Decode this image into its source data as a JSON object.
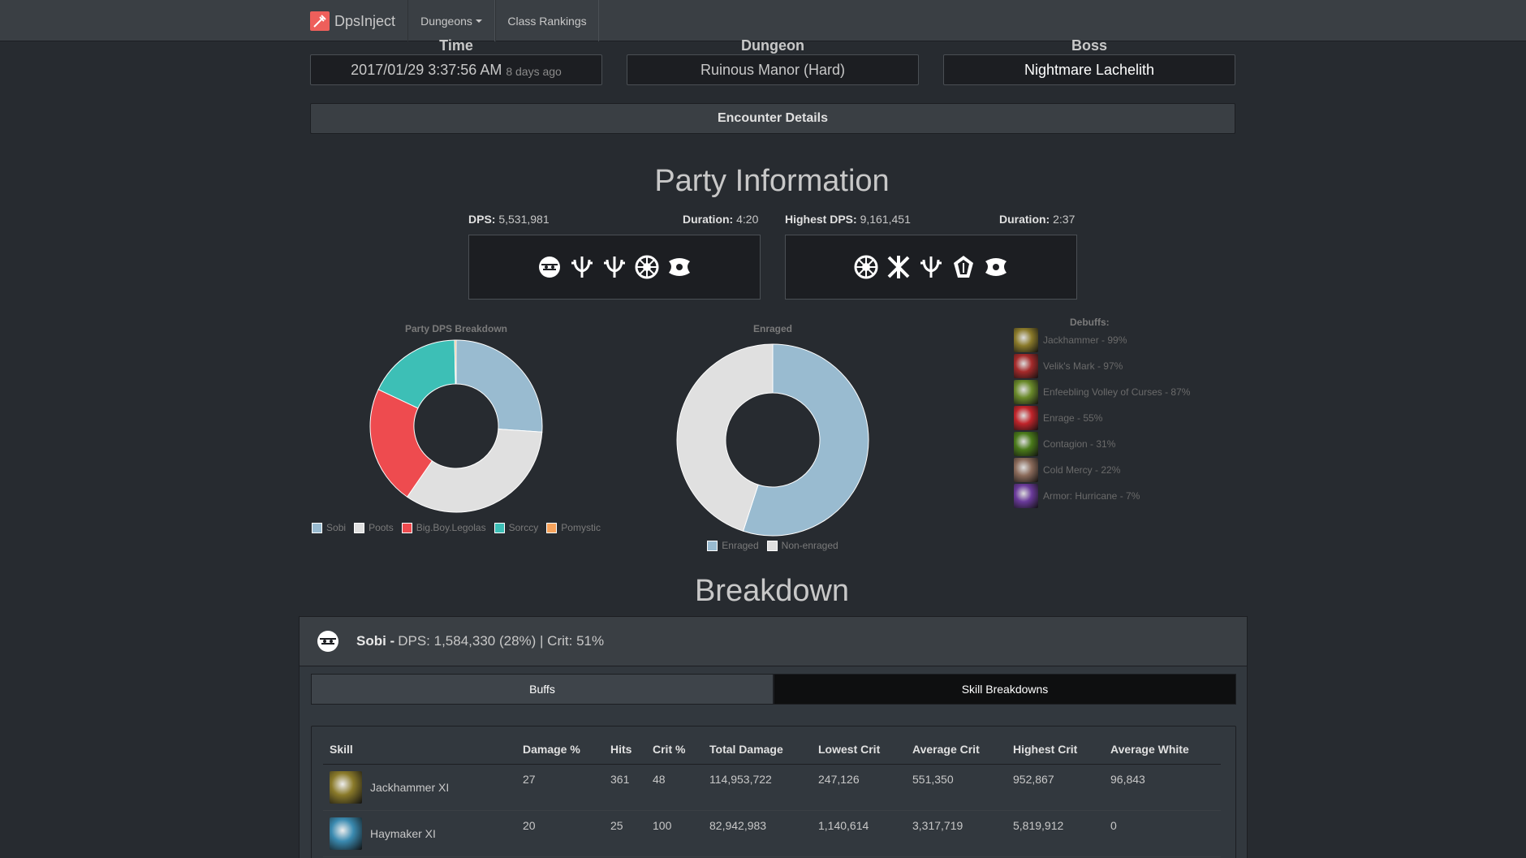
{
  "nav": {
    "brand": "DpsInject",
    "dungeons": "Dungeons",
    "class_rankings": "Class Rankings"
  },
  "meta": {
    "time_label": "Time",
    "time_value": "2017/01/29 3:37:56 AM",
    "time_ago": "8 days ago",
    "dungeon_label": "Dungeon",
    "dungeon_value": "Ruinous Manor (Hard)",
    "boss_label": "Boss",
    "boss_value": "Nightmare Lachelith"
  },
  "encounter_details": "Encounter Details",
  "party": {
    "heading": "Party Information",
    "dps_label": "DPS:",
    "dps_value": "5,531,981",
    "duration_label": "Duration:",
    "duration_value": "4:20",
    "highest_dps_label": "Highest DPS:",
    "highest_dps_value": "9,161,451",
    "highest_duration_label": "Duration:",
    "highest_duration_value": "2:37",
    "party_classes": [
      "destroyer-icon",
      "summoner-icon",
      "summoner-icon",
      "force-master-icon",
      "warlock-icon"
    ],
    "top_classes": [
      "force-master-icon",
      "blade-master-icon",
      "summoner-icon",
      "kung-fu-master-icon",
      "warlock-icon"
    ]
  },
  "colors": {
    "blue": "#99bbd0",
    "white": "#e0e0e0",
    "red": "#ee4b4f",
    "teal": "#3dbfb6",
    "orange": "#f7a35c"
  },
  "chart_data": [
    {
      "type": "pie",
      "title": "Party DPS Breakdown",
      "categories": [
        "Sobi",
        "Poots",
        "Big.Boy.Legolas",
        "Sorccy",
        "Pomystic"
      ],
      "values": [
        28,
        36,
        24,
        19,
        0.3
      ],
      "colors": [
        "#99bbd0",
        "#e0e0e0",
        "#ee4b4f",
        "#3dbfb6",
        "#f7a35c"
      ],
      "legend": "bottom"
    },
    {
      "type": "pie",
      "title": "Enraged",
      "categories": [
        "Enraged",
        "Non-enraged"
      ],
      "values": [
        55,
        45
      ],
      "colors": [
        "#99bbd0",
        "#e0e0e0"
      ],
      "legend": "bottom"
    }
  ],
  "debuffs": {
    "title": "Debuffs:",
    "items": [
      {
        "text": "Jackhammer - 99%",
        "icon": "jackhammer-icon",
        "color": "#8a7a2a"
      },
      {
        "text": "Velik's Mark - 97%",
        "icon": "veliks-mark-icon",
        "color": "#a52a2a"
      },
      {
        "text": "Enfeebling Volley of Curses - 87%",
        "icon": "curses-icon",
        "color": "#6a8a2a"
      },
      {
        "text": "Enrage - 55%",
        "icon": "enrage-icon",
        "color": "#c0242a"
      },
      {
        "text": "Contagion - 31%",
        "icon": "contagion-icon",
        "color": "#4a7a1a"
      },
      {
        "text": "Cold Mercy - 22%",
        "icon": "cold-mercy-icon",
        "color": "#8a6a5a"
      },
      {
        "text": "Armor: Hurricane - 7%",
        "icon": "hurricane-icon",
        "color": "#6a3a9a"
      }
    ]
  },
  "breakdown": {
    "heading": "Breakdown",
    "player_name": "Sobi -",
    "player_stats": "DPS: 1,584,330 (28%) | Crit: 51%",
    "tab_buffs": "Buffs",
    "tab_skills": "Skill Breakdowns",
    "columns": [
      "Skill",
      "Damage %",
      "Hits",
      "Crit %",
      "Total Damage",
      "Lowest Crit",
      "Average Crit",
      "Highest Crit",
      "Average White"
    ],
    "rows": [
      {
        "skill": "Jackhammer XI",
        "icon": "jackhammer-icon",
        "color": "#8a7a2a",
        "cells": [
          "27",
          "361",
          "48",
          "114,953,722",
          "247,126",
          "551,350",
          "952,867",
          "96,843"
        ]
      },
      {
        "skill": "Haymaker XI",
        "icon": "haymaker-icon",
        "color": "#3a8ab0",
        "cells": [
          "20",
          "25",
          "100",
          "82,942,983",
          "1,140,614",
          "3,317,719",
          "5,819,912",
          "0"
        ]
      }
    ]
  }
}
